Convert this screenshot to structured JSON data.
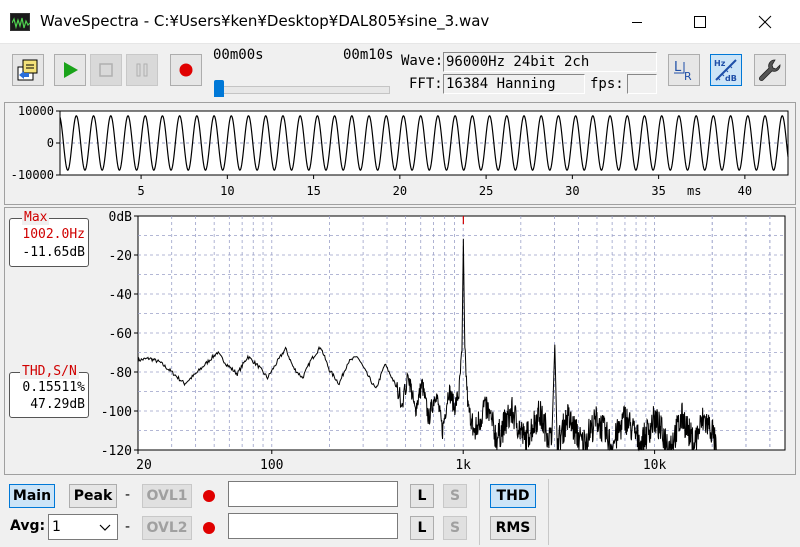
{
  "window": {
    "title": "WaveSpectra - C:¥Users¥ken¥Desktop¥DAL805¥sine_3.wav"
  },
  "toolbar": {
    "time_start": "00m00s",
    "time_end": "00m10s",
    "wave_label": "Wave:",
    "wave_value": "96000Hz 24bit 2ch",
    "fft_label": "FFT:",
    "fft_value": "16384 Hanning",
    "fps_label": "fps:",
    "fps_value": "",
    "position_fraction": 0.0
  },
  "waveform": {
    "y_ticks": [
      "10000",
      "0",
      "-10000"
    ],
    "x_ticks": [
      "5",
      "10",
      "15",
      "20",
      "25",
      "30",
      "35",
      "40"
    ],
    "x_unit": "ms",
    "chart_data": {
      "type": "line",
      "x_range_ms": [
        0.3,
        42.5
      ],
      "ylim": [
        -10000,
        10000
      ],
      "frequency_hz": 1002.0,
      "amplitude": 8500
    }
  },
  "spectrum": {
    "y_ticks": [
      "0dB",
      "-20",
      "-40",
      "-60",
      "-80",
      "-100",
      "-120"
    ],
    "x_ticks": [
      "20",
      "100",
      "1k",
      "10k"
    ],
    "max_label": "Max",
    "max_freq": "1002.0Hz",
    "max_level": "-11.65dB",
    "thd_label": "THD,S/N",
    "thd_value": "0.15511%",
    "sn_value": "47.29dB",
    "chart_data": {
      "type": "line",
      "xscale": "log",
      "xlim": [
        20,
        48000
      ],
      "ylim": [
        -120,
        0
      ],
      "grid": true,
      "peak_marker_hz": 1002,
      "points": [
        [
          20,
          -74
        ],
        [
          23,
          -73
        ],
        [
          26,
          -75
        ],
        [
          30,
          -80
        ],
        [
          35,
          -86
        ],
        [
          40,
          -81
        ],
        [
          46,
          -75
        ],
        [
          52,
          -70
        ],
        [
          58,
          -76
        ],
        [
          66,
          -81
        ],
        [
          75,
          -72
        ],
        [
          85,
          -77
        ],
        [
          95,
          -83
        ],
        [
          105,
          -76
        ],
        [
          118,
          -68
        ],
        [
          130,
          -78
        ],
        [
          145,
          -83
        ],
        [
          160,
          -74
        ],
        [
          180,
          -67
        ],
        [
          200,
          -79
        ],
        [
          225,
          -86
        ],
        [
          250,
          -75
        ],
        [
          280,
          -72
        ],
        [
          310,
          -80
        ],
        [
          350,
          -89
        ],
        [
          390,
          -76
        ],
        [
          430,
          -84
        ],
        [
          480,
          -95
        ],
        [
          520,
          -82
        ],
        [
          560,
          -100
        ],
        [
          610,
          -86
        ],
        [
          660,
          -104
        ],
        [
          720,
          -90
        ],
        [
          780,
          -110
        ],
        [
          840,
          -89
        ],
        [
          900,
          -98
        ],
        [
          950,
          -91
        ],
        [
          985,
          -70
        ],
        [
          1002,
          -11.65
        ],
        [
          1020,
          -70
        ],
        [
          1060,
          -98
        ],
        [
          1150,
          -112
        ],
        [
          1300,
          -96
        ],
        [
          1500,
          -114
        ],
        [
          1800,
          -100
        ],
        [
          2100,
          -115
        ],
        [
          2500,
          -101
        ],
        [
          2900,
          -116
        ],
        [
          3010,
          -66
        ],
        [
          3100,
          -118
        ],
        [
          3500,
          -103
        ],
        [
          4200,
          -117
        ],
        [
          5000,
          -104
        ],
        [
          6000,
          -118
        ],
        [
          7000,
          -103
        ],
        [
          8500,
          -117
        ],
        [
          10000,
          -104
        ],
        [
          12000,
          -118
        ],
        [
          14000,
          -103
        ],
        [
          16000,
          -117
        ],
        [
          18000,
          -104
        ],
        [
          20000,
          -110
        ],
        [
          21000,
          -120
        ]
      ]
    }
  },
  "bottom": {
    "main_label": "Main",
    "peak_label": "Peak",
    "dash1": "-",
    "ovl1_label": "OVL1",
    "avg_label": "Avg:",
    "avg_value": "1",
    "dash2": "-",
    "ovl2_label": "OVL2",
    "l1_label": "L",
    "s1_label": "S",
    "l2_label": "L",
    "s2_label": "S",
    "thd_label": "THD",
    "rms_label": "RMS"
  },
  "colors": {
    "accent": "#0078d7",
    "record": "#e00000",
    "play": "#1aa31a",
    "max_marker": "#d00000",
    "grid": "#9aa0c8"
  }
}
